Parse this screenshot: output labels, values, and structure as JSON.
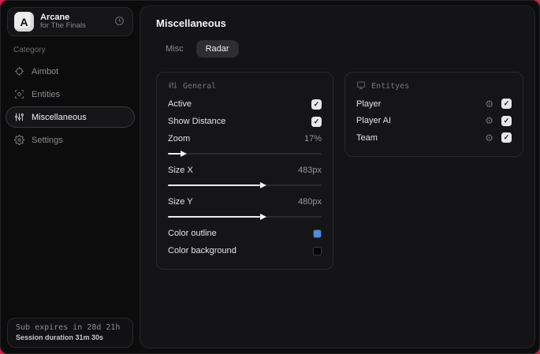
{
  "backdrop_color": "#cb2347",
  "sidebar": {
    "brand": {
      "initial": "A",
      "title": "Arcane",
      "subtitle": "for The Finals"
    },
    "category_label": "Category",
    "items": [
      {
        "label": "Aimbot",
        "icon": "crosshair-icon",
        "active": false
      },
      {
        "label": "Entities",
        "icon": "scan-icon",
        "active": false
      },
      {
        "label": "Miscellaneous",
        "icon": "sliders-icon",
        "active": true
      },
      {
        "label": "Settings",
        "icon": "gear-icon",
        "active": false
      }
    ],
    "footer": {
      "line1": "Sub expires in 28d 21h",
      "line2": "Session duration 31m 30s"
    }
  },
  "main": {
    "title": "Miscellaneous",
    "tabs": [
      {
        "label": "Misc",
        "active": false
      },
      {
        "label": "Radar",
        "active": true
      }
    ],
    "general": {
      "title": "General",
      "toggles": [
        {
          "label": "Active",
          "checked": true
        },
        {
          "label": "Show Distance",
          "checked": true
        }
      ],
      "sliders": [
        {
          "label": "Zoom",
          "value": "17%",
          "fill": "8%"
        },
        {
          "label": "Size X",
          "value": "483px",
          "fill": "60%"
        },
        {
          "label": "Size Y",
          "value": "480px",
          "fill": "60%"
        }
      ],
      "colors": [
        {
          "label": "Color outline",
          "swatch": "#4d8ce0"
        },
        {
          "label": "Color background",
          "swatch": "#050505"
        }
      ]
    },
    "entities": {
      "title": "Entityes",
      "rows": [
        {
          "label": "Player",
          "checked": true
        },
        {
          "label": "Player AI",
          "checked": true
        },
        {
          "label": "Team",
          "checked": true
        }
      ]
    }
  }
}
